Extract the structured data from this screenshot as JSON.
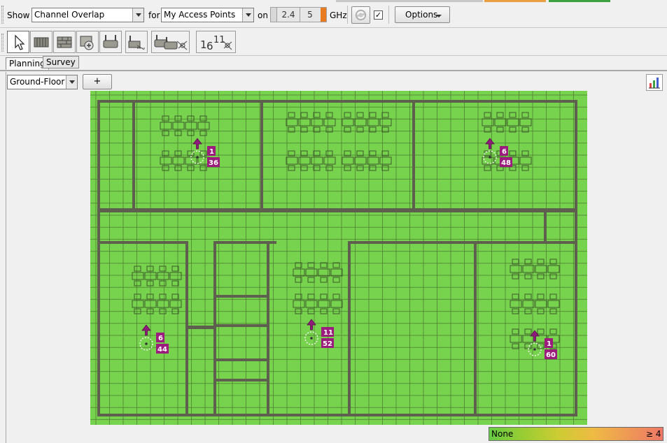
{
  "toolbar": {
    "show_label": "Show",
    "show_value": "Channel Overlap",
    "for_label": "for",
    "for_value": "My Access Points",
    "on_label": "on",
    "freq_24": "2.4",
    "freq_5": "5",
    "unit": "GHz",
    "checkbox_checked": "✓",
    "options_label": "Options"
  },
  "tools": [
    {
      "name": "select-tool"
    },
    {
      "name": "wall-tool"
    },
    {
      "name": "brick-wall-tool"
    },
    {
      "name": "attenuation-zone-tool"
    },
    {
      "name": "access-point-tool"
    },
    {
      "name": "measure-tool"
    },
    {
      "name": "auto-place-ap-tool"
    },
    {
      "name": "auto-channel-tool",
      "text_big": "6",
      "text_small": "11",
      "text_prefix": "1"
    }
  ],
  "tabs": {
    "planning": "Planning",
    "survey": "Survey"
  },
  "floor": {
    "selected": "Ground-Floor",
    "add_label": "+"
  },
  "access_points": [
    {
      "channel": "1",
      "id": "36"
    },
    {
      "channel": "6",
      "id": "48"
    },
    {
      "channel": "6",
      "id": "44"
    },
    {
      "channel": "11",
      "id": "52"
    },
    {
      "channel": "1",
      "id": "60"
    }
  ],
  "legend": {
    "low_label": "None",
    "high_label": "≥ 4",
    "colors": [
      "#66cc44",
      "#99cc33",
      "#cccc33",
      "#eebb44",
      "#ee9955",
      "#ee7766"
    ]
  },
  "colors": {
    "coverage": "#77d24e",
    "ap_badge": "#9b1c7c",
    "wall": "#5a5a4a"
  }
}
